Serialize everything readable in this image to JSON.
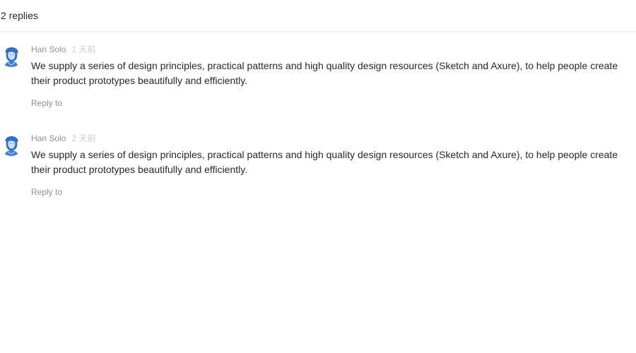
{
  "header": {
    "reply_count_label": "2 replies"
  },
  "comments": [
    {
      "author": "Han Solo",
      "time": "1 天前",
      "text": "We supply a series of design principles, practical patterns and high quality design resources (Sketch and Axure), to help people create their product prototypes beautifully and efficiently.",
      "reply_label": "Reply to",
      "avatar_icon": "user-avatar-icon"
    },
    {
      "author": "Han Solo",
      "time": "2 天前",
      "text": "We supply a series of design principles, practical patterns and high quality design resources (Sketch and Axure), to help people create their product prototypes beautifully and efficiently.",
      "reply_label": "Reply to",
      "avatar_icon": "user-avatar-icon"
    }
  ],
  "colors": {
    "divider": "#e8e8e8",
    "avatar_blue": "#3b7dd8",
    "secondary_text": "#8c8c8c",
    "time_text": "#cccccc"
  }
}
